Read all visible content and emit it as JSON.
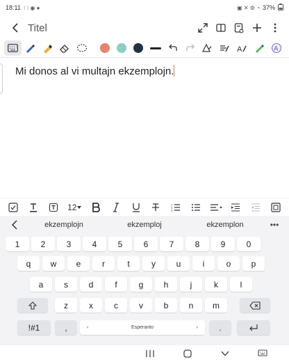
{
  "status_bar": {
    "time": "18:11",
    "battery": "37%"
  },
  "title_bar": {
    "title": "Titel"
  },
  "pen_toolbar": {
    "colors": [
      "#e8826d",
      "#8ccec4",
      "#1f3344"
    ]
  },
  "note": {
    "text": "Mi donos al vi multajn ekzemplojn."
  },
  "format_bar": {
    "font_size": "12"
  },
  "keyboard": {
    "suggestions": [
      "ekzemplojn",
      "ekzemploj",
      "ekzemplon"
    ],
    "more": "•••",
    "row_numbers": [
      "1",
      "2",
      "3",
      "4",
      "5",
      "6",
      "7",
      "8",
      "9",
      "0"
    ],
    "row1": [
      "q",
      "w",
      "e",
      "r",
      "t",
      "y",
      "u",
      "i",
      "o",
      "p"
    ],
    "row2": [
      "a",
      "s",
      "d",
      "f",
      "g",
      "h",
      "j",
      "k",
      "l"
    ],
    "row3": [
      "z",
      "x",
      "c",
      "v",
      "b",
      "n",
      "m"
    ],
    "symbols_key": "!#1",
    "comma_key": ",",
    "space_label": "Esperanto",
    "space_left": "‹",
    "space_right": "›",
    "period_key": "."
  }
}
